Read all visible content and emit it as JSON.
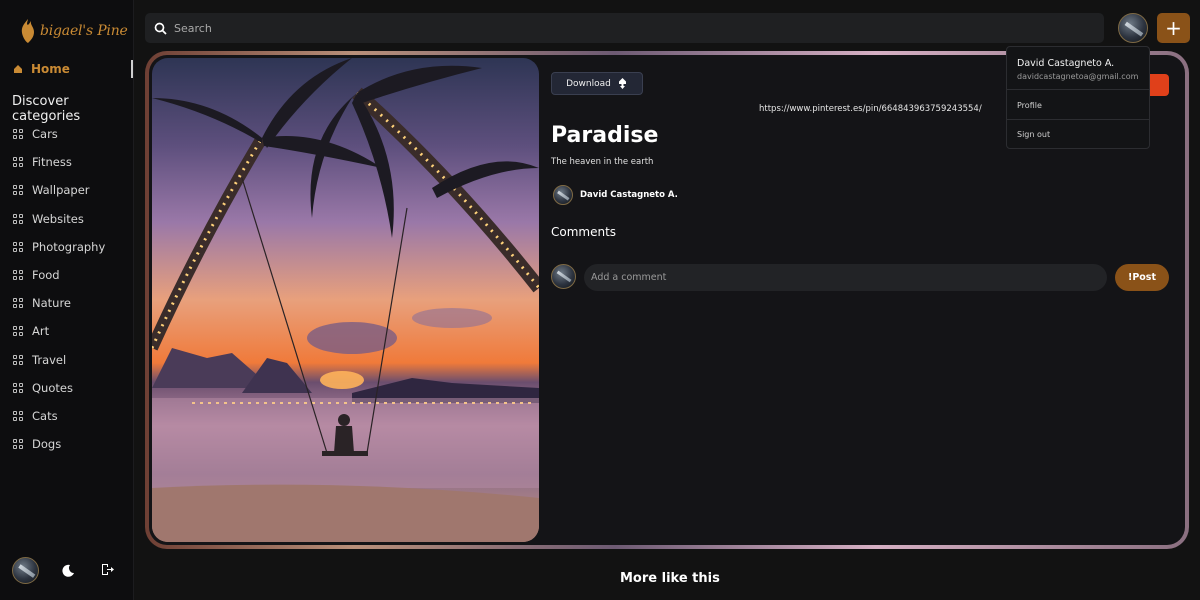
{
  "brand": {
    "name": "bigael's Pine",
    "accent": "#c98a34"
  },
  "sidebar": {
    "home_label": "Home",
    "categories_title": "Discover categories",
    "categories": [
      "Cars",
      "Fitness",
      "Wallpaper",
      "Websites",
      "Photography",
      "Food",
      "Nature",
      "Art",
      "Travel",
      "Quotes",
      "Cats",
      "Dogs"
    ],
    "icons": [
      "avatar",
      "moon-icon",
      "logout-icon"
    ]
  },
  "header": {
    "search_placeholder": "Search",
    "add_label": "+"
  },
  "pin": {
    "download_label": "Download",
    "url": "https://www.pinterest.es/pin/664843963759243554/",
    "title": "Paradise",
    "description": "The heaven in the earth",
    "author": "David Castagneto A.",
    "comments_title": "Comments",
    "comment_placeholder": "Add a comment",
    "post_label": "!Post"
  },
  "user_menu": {
    "name": "David Castagneto A.",
    "email": "davidcastagnetoa@gmail.com",
    "items": [
      "Profile",
      "Sign out"
    ]
  },
  "footer": {
    "more_title": "More like this"
  },
  "colors": {
    "accent_button": "#8a5218",
    "save_red": "#e0401a",
    "background": "#121212"
  }
}
